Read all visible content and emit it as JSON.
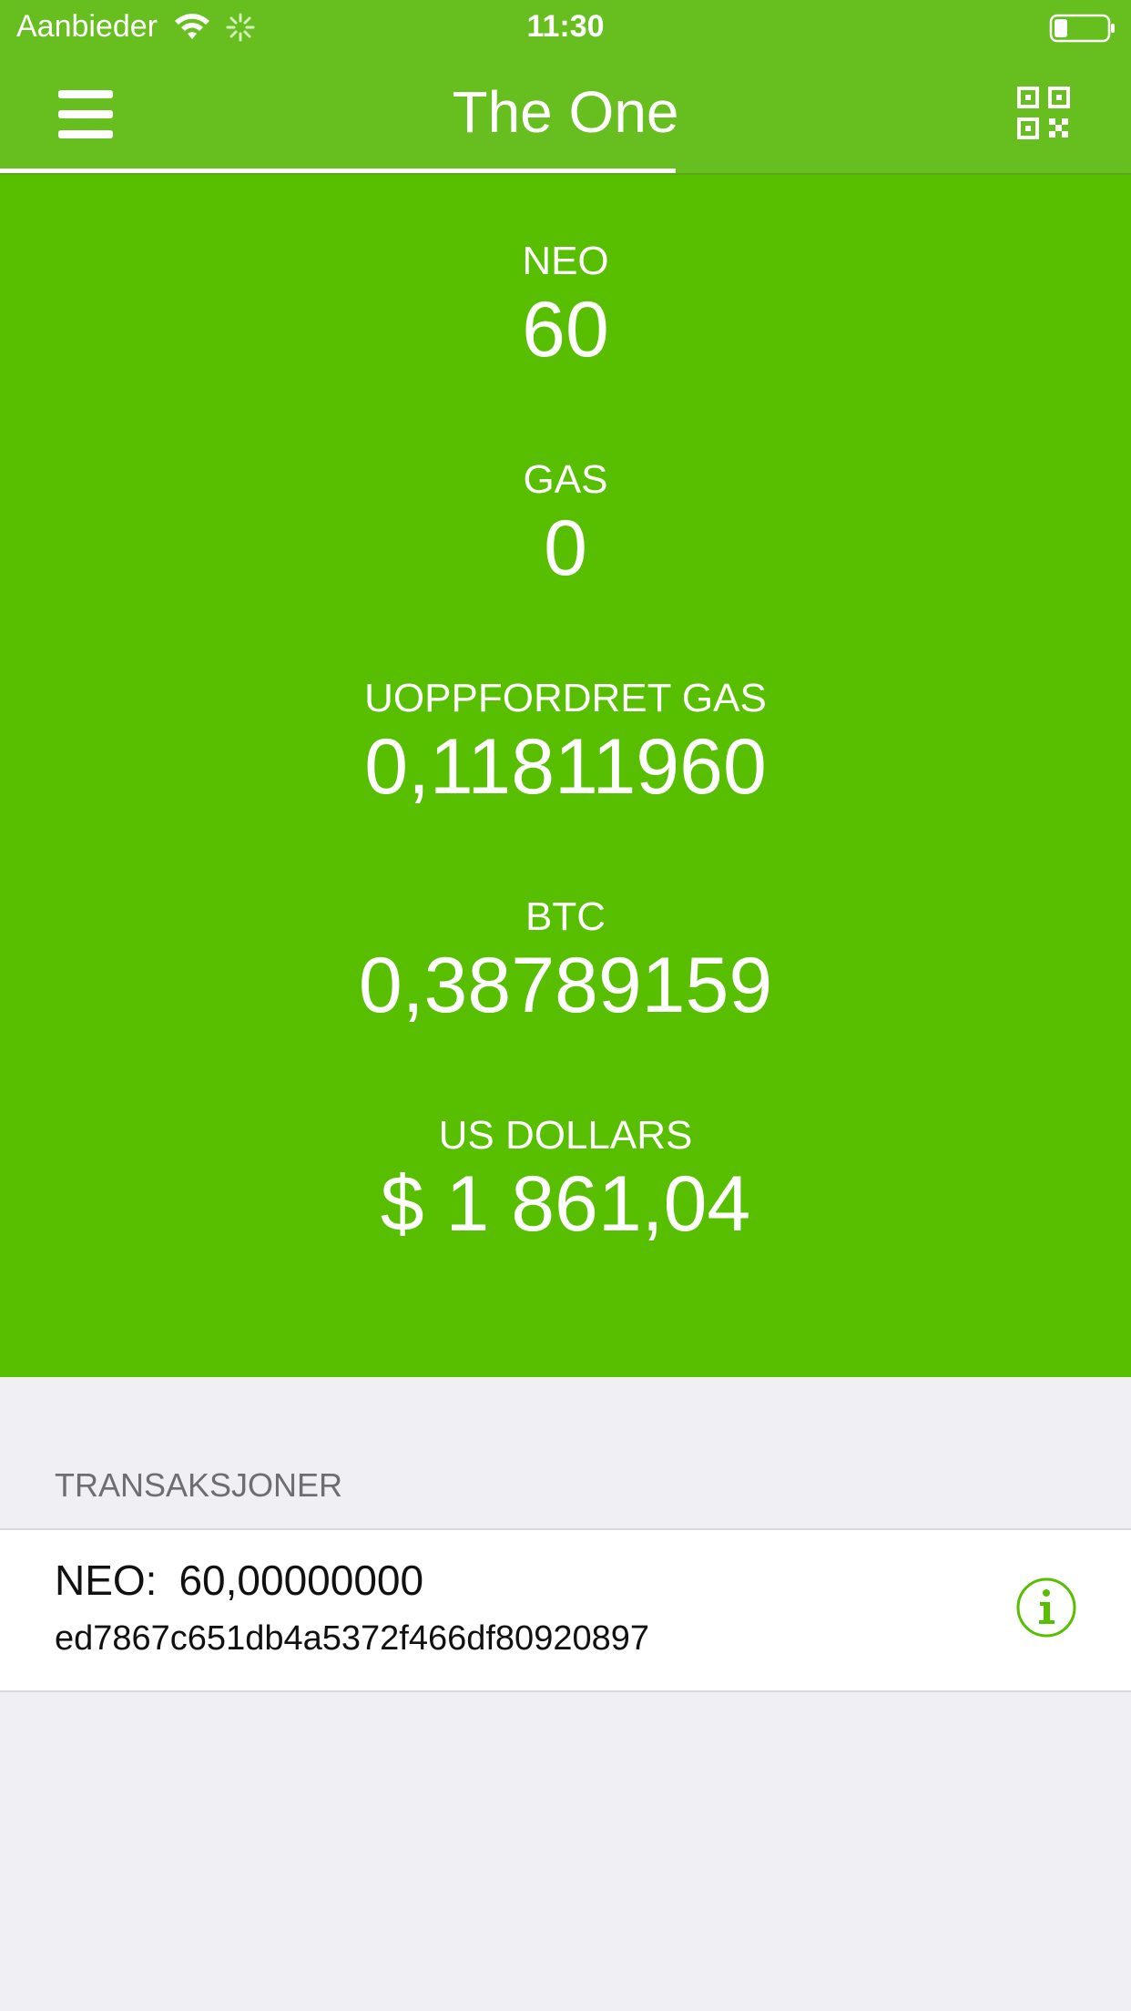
{
  "status_bar": {
    "carrier": "Aanbieder",
    "time": "11:30",
    "icons": [
      "wifi-icon",
      "activity-spinner-icon",
      "battery-icon"
    ]
  },
  "nav": {
    "title": "The One",
    "left_icon": "menu-icon",
    "right_icon": "qr-code-icon",
    "accent_color": "#67bf1f"
  },
  "balances": {
    "background_color": "#58bf00",
    "items": [
      {
        "label": "NEO",
        "value": "60"
      },
      {
        "label": "GAS",
        "value": "0"
      },
      {
        "label": "UOPPFORDRET GAS",
        "value": "0,11811960"
      },
      {
        "label": "BTC",
        "value": "0,38789159"
      },
      {
        "label": "US DOLLARS",
        "value": "$ 1 861,04"
      }
    ]
  },
  "transactions": {
    "header": "TRANSAKSJONER",
    "items": [
      {
        "asset": "NEO:",
        "amount": "60,00000000",
        "hash": "ed7867c651db4a5372f466df80920897",
        "icon": "info-icon"
      }
    ]
  }
}
